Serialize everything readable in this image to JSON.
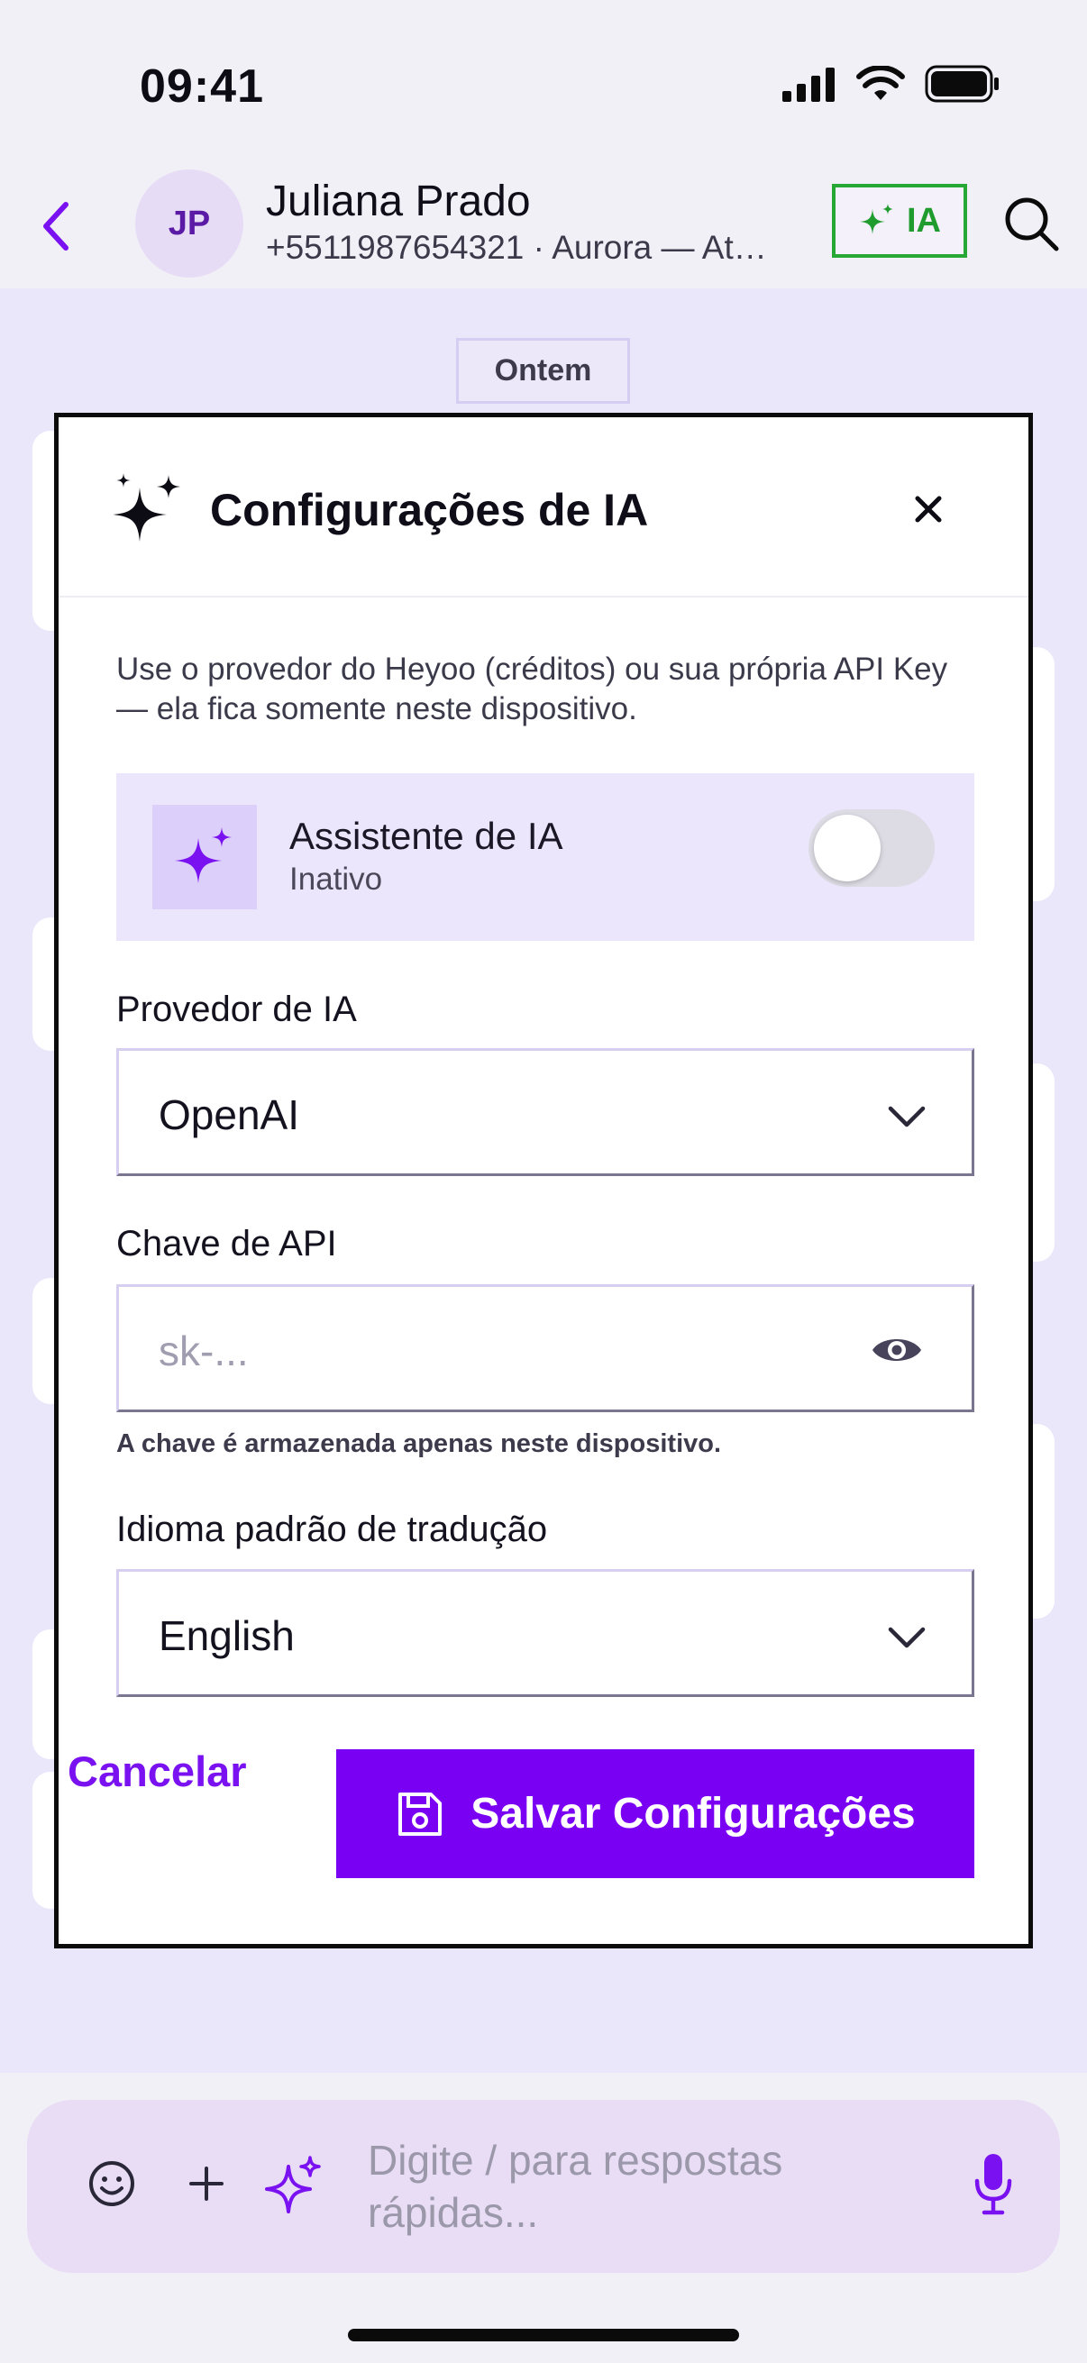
{
  "status_bar": {
    "time": "09:41"
  },
  "header": {
    "avatar_initials": "JP",
    "contact_name": "Juliana Prado",
    "contact_subtitle": "+5511987654321 · Aurora — Atendimento",
    "ia_button_label": "IA",
    "ia_button_color": "#27a834"
  },
  "chat": {
    "date_chip": "Ontem"
  },
  "modal": {
    "title": "Configurações de IA",
    "description": "Use o provedor do Heyoo (créditos) ou sua própria API Key — ela fica somente neste dispositivo.",
    "assistant": {
      "title": "Assistente de IA",
      "status": "Inativo",
      "enabled": false
    },
    "provider": {
      "label": "Provedor de IA",
      "value": "OpenAI"
    },
    "api_key": {
      "label": "Chave de API",
      "placeholder": "sk-...",
      "helper": "A chave é armazenada apenas neste dispositivo."
    },
    "language": {
      "label": "Idioma padrão de tradução",
      "value": "English"
    },
    "cancel_label": "Cancelar",
    "save_label": "Salvar Configurações",
    "accent_color": "#7a00f4"
  },
  "composer": {
    "placeholder": "Digite / para respostas rápidas..."
  }
}
